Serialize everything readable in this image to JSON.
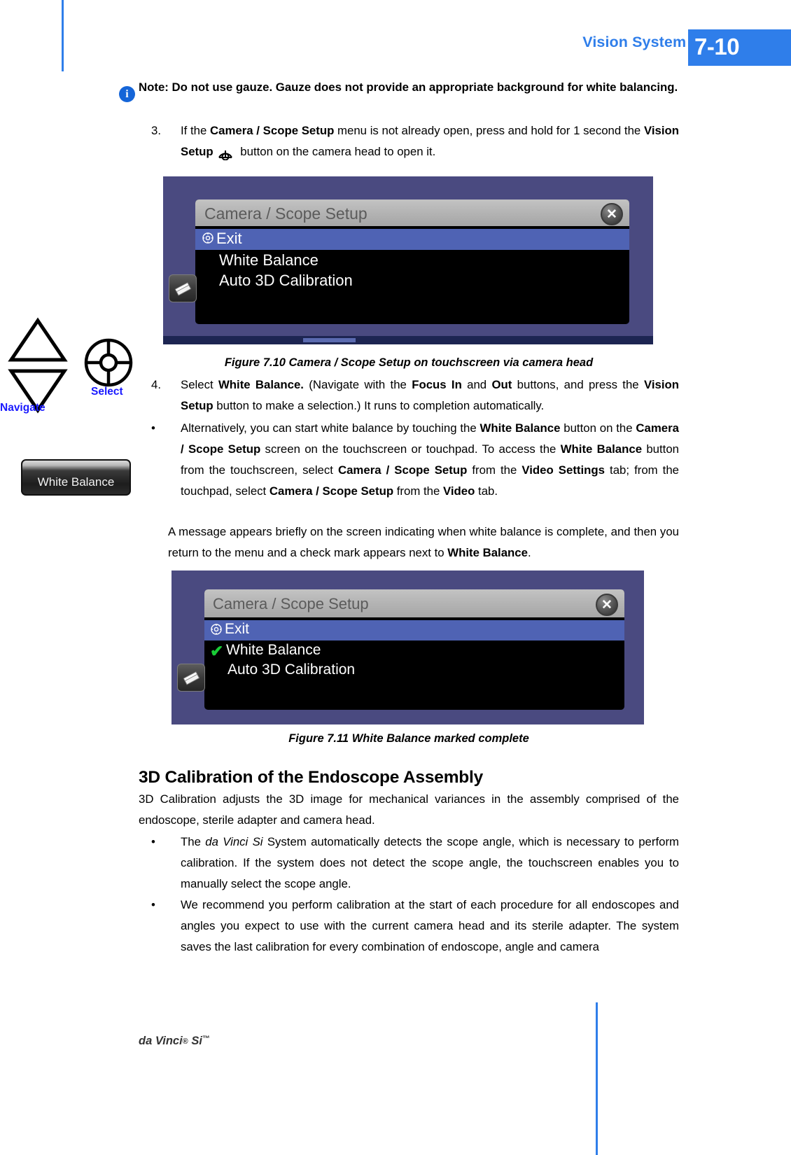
{
  "header": {
    "running_title": "Vision System Use",
    "page_number": "7-10"
  },
  "note": {
    "icon": "info-icon",
    "text": "Note: Do not use gauze. Gauze does not provide an appropriate background for white balancing."
  },
  "steps": [
    {
      "number": "3.",
      "text_before": "If the ",
      "bold1": "Camera / Scope Setup",
      "text_mid": " menu is not already open, press and hold for 1 second the ",
      "bold2": "Vision Setup",
      "text_after": " button on the camera head to open it.",
      "icon": "vision-setup-icon"
    },
    {
      "number": "4.",
      "text_before": "Select ",
      "bold1": "White Balance.",
      "text_mid": " (Navigate with the ",
      "bold2": "Focus In",
      "text_mid2": " and ",
      "bold3": "Out",
      "text_mid3": " buttons, and press the ",
      "bold4": "Vision Setup",
      "text_after": " button to make a selection.) It runs to completion automatically."
    }
  ],
  "bullets": {
    "alternatively": {
      "marker": "•",
      "p1": "Alternatively, you can start white balance by touching the ",
      "b1": "White Balance",
      "p2": " button on the ",
      "b2": "Camera / Scope Setup",
      "p3": " screen on the touchscreen or touchpad. To access the ",
      "b3": "White Balance",
      "p4": " button from the touchscreen, select ",
      "b4": "Camera / Scope Setup",
      "p5": " from the ",
      "b5": "Video Settings",
      "p6": " tab; from the touchpad, select ",
      "b6": "Camera / Scope Setup",
      "p7": " from the ",
      "b7": "Video",
      "p8": " tab."
    },
    "scope_angle": {
      "marker": "•",
      "p1": "The ",
      "i1": "da Vinci Si",
      "p2": " System automatically detects the scope angle, which is necessary to perform calibration. If the system does not detect the scope angle, the touchscreen enables you to manually select the scope angle."
    },
    "recommend": {
      "marker": "•",
      "p1": "We recommend you perform calibration at the start of each procedure for all endoscopes and angles you expect to use with the current camera head and its sterile adapter. The system saves the last calibration for every combination of endoscope, angle and camera"
    }
  },
  "paragraphs": {
    "message_appears": {
      "p1": "A message appears briefly on the screen indicating when white balance is complete, and then you return to the menu and a check mark appears next to ",
      "b1": "White Balance",
      "p2": "."
    },
    "calibration_intro": "3D Calibration adjusts the 3D image for mechanical variances in the assembly comprised of the endoscope, sterile adapter and camera head."
  },
  "headings": {
    "calibration": "3D Calibration of the Endoscope Assembly"
  },
  "figures": [
    {
      "id": "figure-7-10",
      "title": "Camera / Scope Setup",
      "close_label": "✕",
      "rows": [
        {
          "label": "Exit",
          "selected": true,
          "checked": false,
          "icon": "target-icon"
        },
        {
          "label": "White Balance",
          "selected": false,
          "checked": false,
          "icon": ""
        },
        {
          "label": "Auto 3D Calibration",
          "selected": false,
          "checked": false,
          "icon": ""
        }
      ],
      "side_button_icon": "eraser-icon",
      "caption": "Figure 7.10 Camera / Scope Setup on touchscreen via camera head"
    },
    {
      "id": "figure-7-11",
      "title": "Camera / Scope Setup",
      "close_label": "✕",
      "rows": [
        {
          "label": "Exit",
          "selected": true,
          "checked": false,
          "icon": "target-icon"
        },
        {
          "label": "White Balance",
          "selected": false,
          "checked": true,
          "icon": ""
        },
        {
          "label": "Auto 3D Calibration",
          "selected": false,
          "checked": false,
          "icon": ""
        }
      ],
      "side_button_icon": "eraser-icon",
      "caption": "Figure 7.11 White Balance marked complete"
    }
  ],
  "margin": {
    "navigate_label": "Navigate",
    "select_label": "Select",
    "up_icon": "triangle-up-icon",
    "down_icon": "triangle-down-icon",
    "select_icon": "vision-setup-target-icon",
    "white_balance_button": "White Balance"
  },
  "footer": {
    "product": "da Vinci",
    "reg": "®",
    "model": " Si",
    "tm": "™"
  },
  "colors": {
    "accent_blue": "#2f7eea",
    "link_blue": "#1a1aff",
    "figure_frame": "#4a4a80",
    "row_selected": "#4f63b4",
    "check_green": "#19cc36"
  }
}
